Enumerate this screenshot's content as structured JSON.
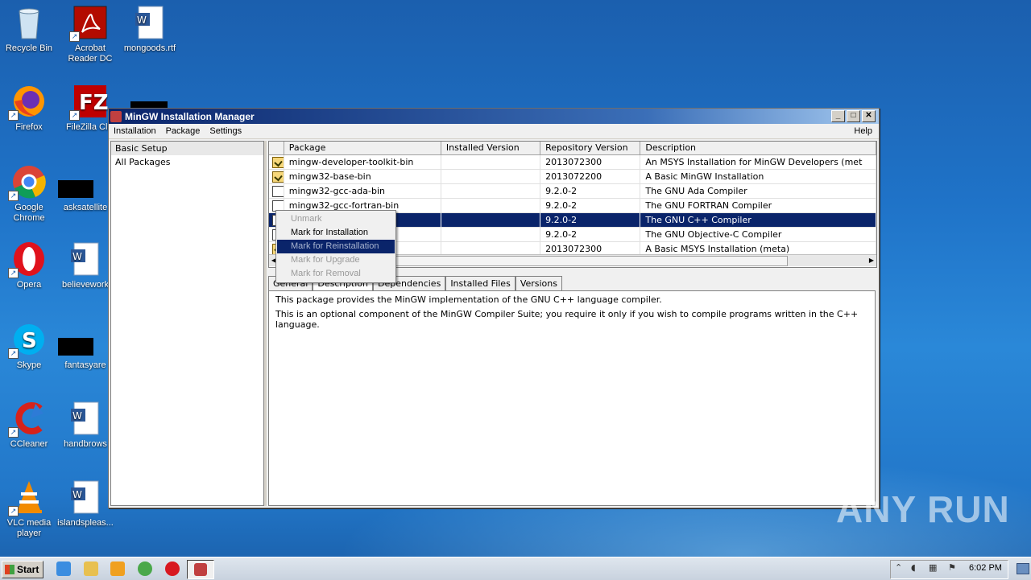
{
  "desktop": {
    "icons": [
      {
        "label": "Recycle Bin"
      },
      {
        "label": "Acrobat Reader DC"
      },
      {
        "label": "mongoods.rtf"
      },
      {
        "label": "Firefox"
      },
      {
        "label": "FileZilla Clie"
      },
      {
        "label": "Google Chrome"
      },
      {
        "label": "asksatellite"
      },
      {
        "label": "Opera"
      },
      {
        "label": "believework"
      },
      {
        "label": "Skype"
      },
      {
        "label": "fantasyare"
      },
      {
        "label": "CCleaner"
      },
      {
        "label": "handbrows"
      },
      {
        "label": "VLC media player"
      },
      {
        "label": "islandspleas..."
      }
    ]
  },
  "window": {
    "title": "MinGW Installation Manager",
    "menu": [
      "Installation",
      "Package",
      "Settings"
    ],
    "help": "Help",
    "left_items": [
      "Basic Setup",
      "All Packages"
    ],
    "columns": [
      "Package",
      "Installed Version",
      "Repository Version",
      "Description"
    ],
    "rows": [
      {
        "package": "mingw-developer-toolkit-bin",
        "installed": "",
        "repo": "2013072300",
        "desc": "An MSYS Installation for MinGW Developers (met",
        "state": "installed"
      },
      {
        "package": "mingw32-base-bin",
        "installed": "",
        "repo": "2013072200",
        "desc": "A Basic MinGW Installation",
        "state": "installed"
      },
      {
        "package": "mingw32-gcc-ada-bin",
        "installed": "",
        "repo": "9.2.0-2",
        "desc": "The GNU Ada Compiler",
        "state": "none"
      },
      {
        "package": "mingw32-gcc-fortran-bin",
        "installed": "",
        "repo": "9.2.0-2",
        "desc": "The GNU FORTRAN Compiler",
        "state": "none"
      },
      {
        "package": "",
        "installed": "",
        "repo": "9.2.0-2",
        "desc": "The GNU C++ Compiler",
        "state": "none"
      },
      {
        "package": "",
        "installed": "",
        "repo": "9.2.0-2",
        "desc": "The GNU Objective-C Compiler",
        "state": "none"
      },
      {
        "package": "",
        "installed": "",
        "repo": "2013072300",
        "desc": "A Basic MSYS Installation (meta)",
        "state": "installed"
      }
    ],
    "tabs": [
      "General",
      "Description",
      "Dependencies",
      "Installed Files",
      "Versions"
    ],
    "description": [
      "This package provides the MinGW implementation of the GNU C++ language compiler.",
      "This is an optional component of the MinGW Compiler Suite; you require it only if you wish to compile programs written in the C++ language."
    ]
  },
  "context_menu": [
    {
      "label": "Unmark",
      "enabled": false
    },
    {
      "label": "Mark for Installation",
      "enabled": true
    },
    {
      "label": "Mark for Reinstallation",
      "enabled": false,
      "highlighted": true
    },
    {
      "label": "Mark for Upgrade",
      "enabled": false
    },
    {
      "label": "Mark for Removal",
      "enabled": false
    }
  ],
  "taskbar": {
    "start": "Start",
    "clock": "6:02 PM"
  },
  "watermark": "ANY RUN",
  "colors": {
    "selection": "#0a246a",
    "titlebar": "#0a246a",
    "desktop": "#1f73c8"
  }
}
